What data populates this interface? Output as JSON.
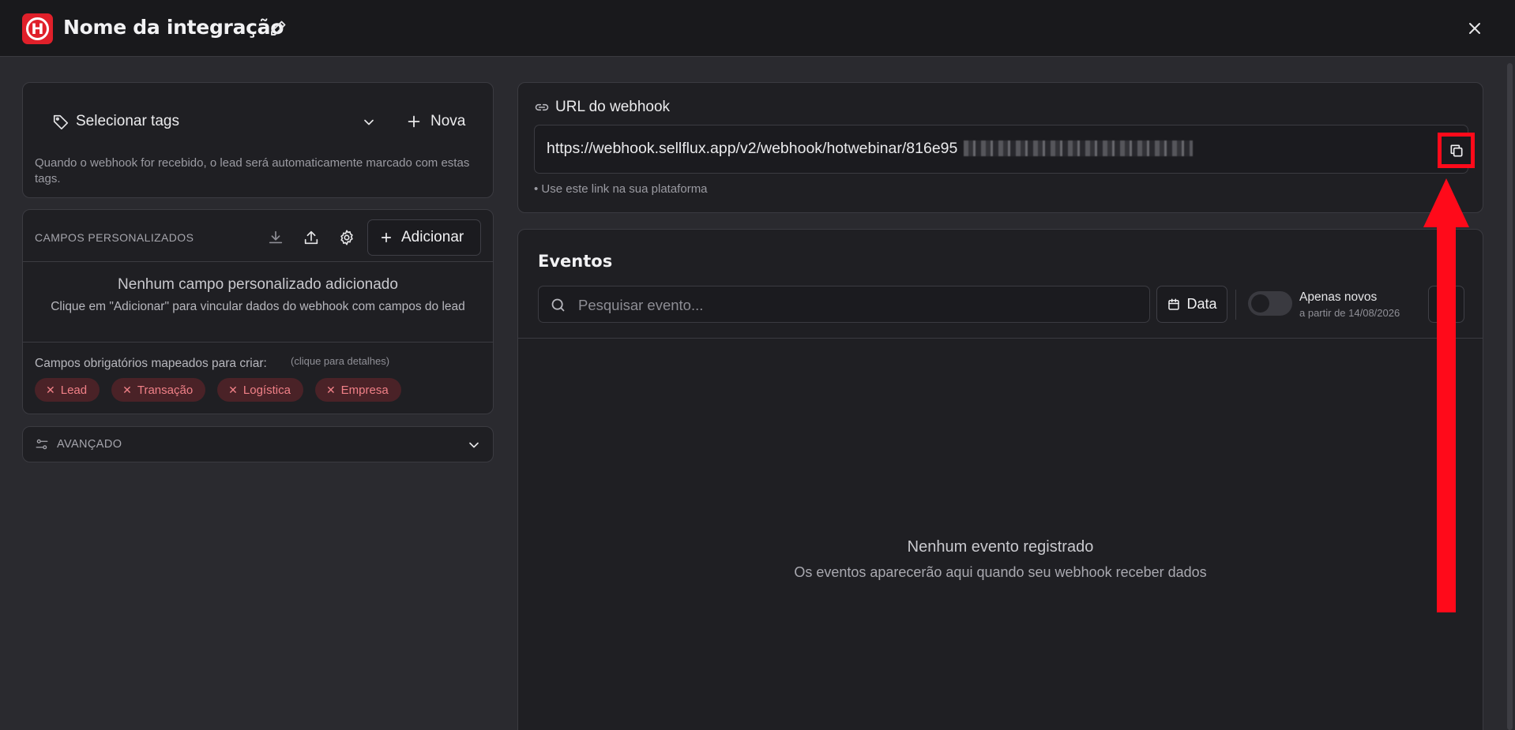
{
  "header": {
    "logo_letter": "H",
    "title": "Nome da integração"
  },
  "tags": {
    "select_label": "Selecionar tags",
    "new_label": "Nova",
    "help": "Quando o webhook for recebido, o lead será automaticamente marcado com estas tags."
  },
  "custom_fields": {
    "title": "CAMPOS PERSONALIZADOS",
    "add_label": "Adicionar",
    "empty_title": "Nenhum campo personalizado adicionado",
    "empty_sub": "Clique em \"Adicionar\" para vincular dados do webhook com campos do lead",
    "required_label": "Campos obrigatórios mapeados para criar:",
    "required_hint": "(clique para detalhes)",
    "chips": [
      "Lead",
      "Transação",
      "Logística",
      "Empresa"
    ]
  },
  "advanced": {
    "label": "AVANÇADO"
  },
  "webhook": {
    "title": "URL do webhook",
    "url_visible": "https://webhook.sellflux.app/v2/webhook/hotwebinar/816e95",
    "note": "• Use este link na sua plataforma"
  },
  "events": {
    "title": "Eventos",
    "search_placeholder": "Pesquisar evento...",
    "date_label": "Data",
    "only_new_label": "Apenas novos",
    "only_new_sub": "a partir de 14/08/2026",
    "only_new_enabled": false,
    "empty_title": "Nenhum evento registrado",
    "empty_sub": "Os eventos aparecerão aqui quando seu webhook receber dados"
  },
  "colors": {
    "annotation": "#ff0a1a",
    "brand": "#e0202a",
    "chip_bg": "#4a2227",
    "chip_text": "#f08087"
  },
  "icons": [
    "tag-icon",
    "chevron-down-icon",
    "plus-icon",
    "download-icon",
    "upload-icon",
    "gear-icon",
    "sliders-icon",
    "link-icon",
    "copy-icon",
    "search-icon",
    "calendar-icon",
    "close-icon",
    "pencil-icon"
  ]
}
